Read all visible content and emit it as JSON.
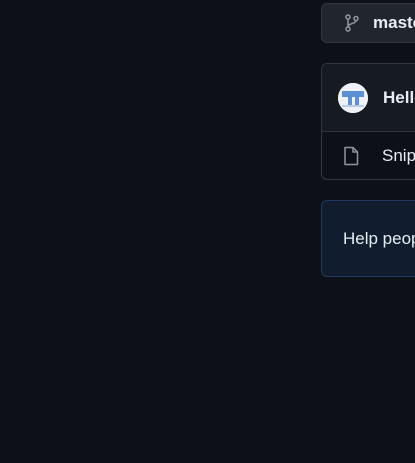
{
  "branch_selector": {
    "label": "master",
    "icon": "git-branch-icon"
  },
  "latest_commit": {
    "author": "Hello",
    "avatar_icon": "avatar"
  },
  "files": [
    {
      "name": "Snippets",
      "icon": "file-icon"
    }
  ],
  "flash": {
    "text": "Help people"
  },
  "colors": {
    "background": "#0d1117",
    "border": "#30363d",
    "button_bg": "#21262d",
    "header_bg": "#161b22",
    "flash_bg": "#111d2e",
    "flash_border": "#1f3a5f",
    "text": "#e6edf3",
    "muted_icon": "#8d96a0"
  }
}
